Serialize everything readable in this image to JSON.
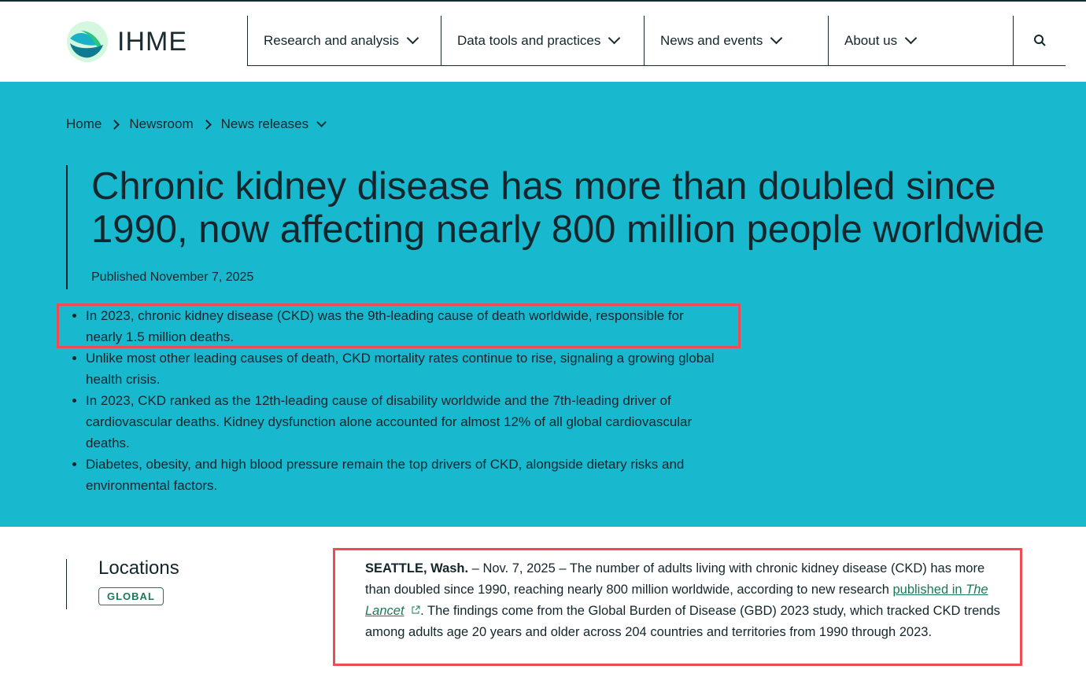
{
  "brand": {
    "name": "IHME"
  },
  "nav": {
    "items": [
      {
        "label": "Research and analysis"
      },
      {
        "label": "Data tools and practices"
      },
      {
        "label": "News and events"
      },
      {
        "label": "About us"
      }
    ],
    "search_icon": "search-icon"
  },
  "breadcrumb": {
    "items": [
      "Home",
      "Newsroom",
      "News releases"
    ]
  },
  "article": {
    "title": "Chronic kidney disease has more than doubled since 1990, now affecting nearly 800 million people worldwide",
    "published": "Published November 7, 2025",
    "bullets": [
      "In 2023, chronic kidney disease (CKD) was the 9th-leading cause of death worldwide, responsible for nearly 1.5 million deaths.",
      "Unlike most other leading causes of death, CKD mortality rates continue to rise, signaling a growing global health crisis.",
      "In 2023, CKD ranked as the 12th-leading cause of disability worldwide and the 7th-leading driver of cardiovascular deaths. Kidney dysfunction alone accounted for almost 12% of all global cardiovascular deaths.",
      "Diabetes, obesity, and high blood pressure remain the top drivers of CKD, alongside dietary risks and environmental factors."
    ],
    "locations_heading": "Locations",
    "location_badge": "GLOBAL",
    "dateline": "SEATTLE, Wash.",
    "body_1": " – Nov. 7, 2025 – The number of adults living with chronic kidney disease (CKD) has more than doubled since 1990, reaching nearly 800 million worldwide, according to new research ",
    "link_pre": "published in ",
    "link_italic": "The Lancet",
    "body_2": ". The findings come from the Global Burden of Disease (GBD) 2023 study, which tracked CKD trends among adults age 20 years and older across 204 countries and territories from 1990 through 2023."
  },
  "colors": {
    "hero": "#18b8cf",
    "highlight": "#ef4b55",
    "link": "#1a7a55"
  }
}
